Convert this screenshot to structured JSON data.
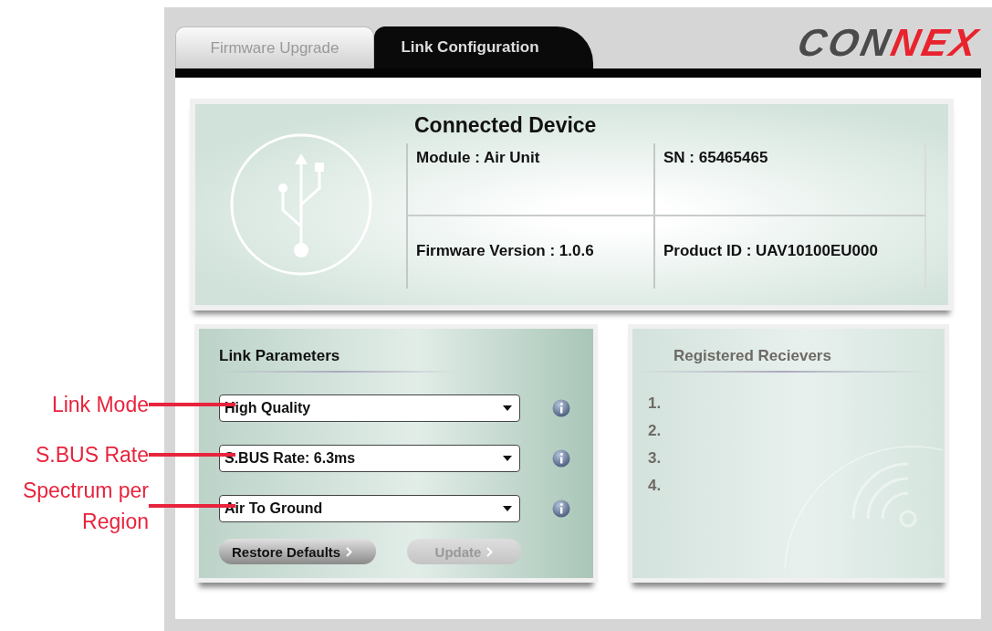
{
  "tabs": [
    {
      "label": "Firmware Upgrade",
      "selected": false
    },
    {
      "label": "Link Configuration",
      "selected": true
    }
  ],
  "logo": {
    "first": "CON",
    "second": "NEX"
  },
  "connected_device": {
    "title": "Connected Device",
    "fields": [
      "Module : Air Unit",
      "SN : 65465465",
      "Firmware Version : 1.0.6",
      "Product ID : UAV10100EU000"
    ]
  },
  "link_parameters": {
    "title": "Link Parameters",
    "dropdowns": [
      {
        "value": "High Quality"
      },
      {
        "value": "S.BUS Rate: 6.3ms"
      },
      {
        "value": "Air To Ground"
      }
    ],
    "buttons": [
      {
        "label": "Restore Defaults",
        "disabled": false
      },
      {
        "label": "Update",
        "disabled": true
      }
    ]
  },
  "registered_receivers": {
    "title": "Registered Recievers",
    "items": [
      "1.",
      "2.",
      "3.",
      "4."
    ]
  },
  "annotations": [
    {
      "text": "Link Mode"
    },
    {
      "text": "S.BUS Rate"
    },
    {
      "text": "Spectrum per Region"
    }
  ]
}
